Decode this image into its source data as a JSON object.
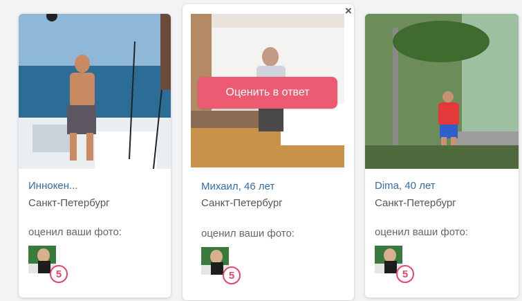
{
  "close_icon": "×",
  "rate_back_button": "Оценить в ответ",
  "cards": [
    {
      "name": "Иннокен...",
      "city": "Санкт-Петербург",
      "rated_label": "оценил ваши фото:",
      "rating": "5"
    },
    {
      "name": "Михаил, 46 лет",
      "city": "Санкт-Петербург",
      "rated_label": "оценил ваши фото:",
      "rating": "5"
    },
    {
      "name": "Dima, 40 лет",
      "city": "Санкт-Петербург",
      "rated_label": "оценил ваши фото:",
      "rating": "5"
    }
  ],
  "colors": {
    "accent": "#ec5b72",
    "link": "#2f6db0",
    "badge": "#e84468"
  }
}
